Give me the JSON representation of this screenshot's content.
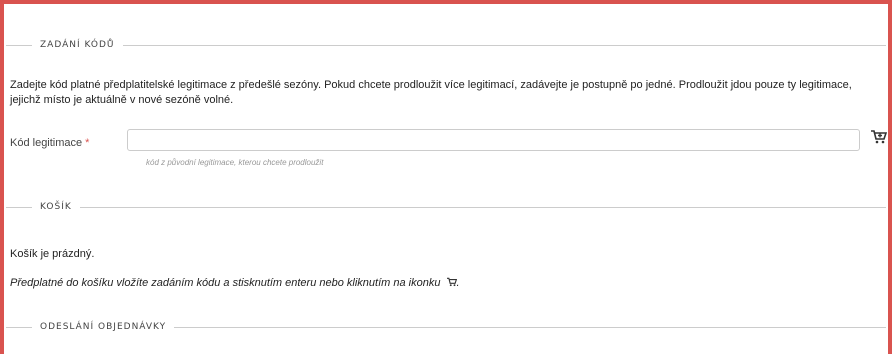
{
  "sections": {
    "code_entry": {
      "legend": "ZADÁNÍ KÓDŮ",
      "description_line1": "Zadejte kód platné předplatitelské legitimace z předešlé sezóny. Pokud chcete prodloužit více legitimací, zadávejte je postupně po jedné. Prodloužit jdou pouze ty legitimace,",
      "description_line2": "jejichž místo je aktuálně v nové sezóně volné.",
      "field_label": "Kód legitimace",
      "required_mark": "*",
      "field_value": "",
      "field_hint": "kód z původní legitimace, kterou chcete prodloužit",
      "add_icon": "cart-add-icon"
    },
    "cart": {
      "legend": "KOŠÍK",
      "empty_text": "Košík je prázdný.",
      "instructions": "Předplatné do košíku vložíte zadáním kódu a stisknutím enteru nebo kliknutím na ikonku",
      "instructions_end": ".",
      "inline_icon": "cart-icon"
    },
    "order": {
      "legend": "ODESLÁNÍ OBJEDNÁVKY"
    }
  },
  "colors": {
    "accent_border": "#d9534f",
    "divider": "#cccccc",
    "hint_text": "#999999"
  }
}
